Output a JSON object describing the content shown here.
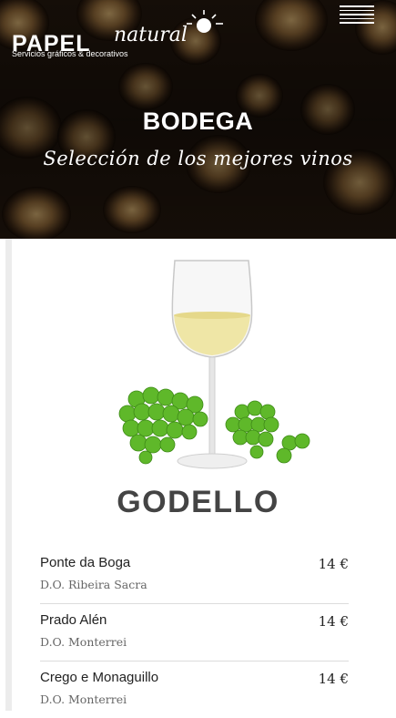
{
  "brand": {
    "name_primary": "PAPEL",
    "name_secondary": "natural",
    "tagline": "Servicios gráficos & decorativos",
    "logo_icon": "sun-icon"
  },
  "header": {
    "menu_icon": "hamburger-menu-icon",
    "title": "BODEGA",
    "subtitle": "Selección de los mejores vinos"
  },
  "section": {
    "image_icon": "white-wine-glass-with-grapes",
    "title": "GODELLO"
  },
  "wines": [
    {
      "name": "Ponte da Boga",
      "origin": "D.O. Ribeira Sacra",
      "price": "14 €"
    },
    {
      "name": "Prado Alén",
      "origin": "D.O. Monterrei",
      "price": "14 €"
    },
    {
      "name": "Crego e Monaguillo",
      "origin": "D.O. Monterrei",
      "price": "14 €"
    }
  ],
  "colors": {
    "hero_dark": "#2a1d12",
    "heading": "#444444",
    "divider": "#dcdcdc",
    "grape_green": "#5fb82a",
    "wine_yellow": "#efe6a6"
  }
}
